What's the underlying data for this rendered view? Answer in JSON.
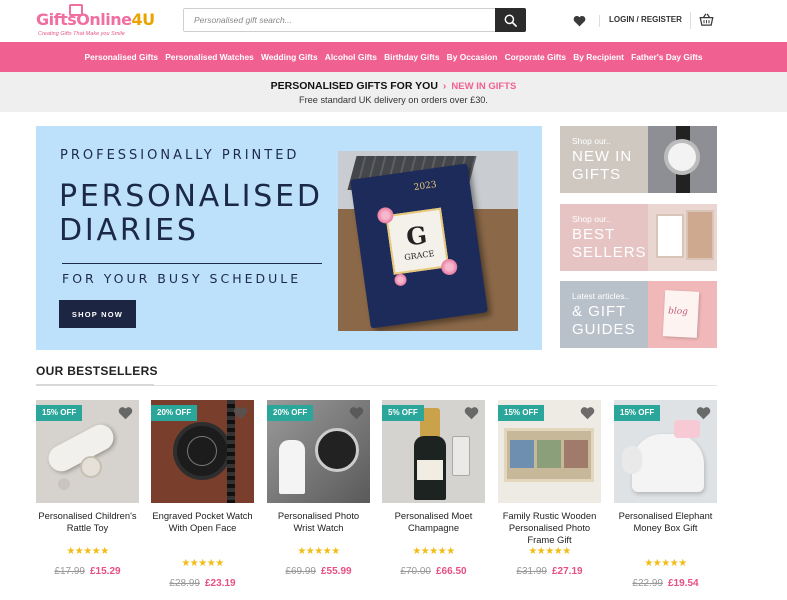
{
  "brand": {
    "logo_part1": "Gifts",
    "logo_part2": "Online",
    "logo_part3": "4U",
    "tagline": "Creating Gifts That Make you Smile"
  },
  "search": {
    "placeholder": "Personalised gift search..."
  },
  "account": {
    "login_label": "LOGIN / REGISTER"
  },
  "nav": {
    "items": [
      "Personalised Gifts",
      "Personalised Watches",
      "Wedding Gifts",
      "Alcohol Gifts",
      "Birthday Gifts",
      "By Occasion",
      "Corporate Gifts",
      "By Recipient",
      "Father's Day Gifts"
    ]
  },
  "promo": {
    "headline": "PERSONALISED GIFTS FOR YOU",
    "link": "NEW IN GIFTS",
    "delivery": "Free standard UK delivery on orders over £30."
  },
  "hero": {
    "eyebrow": "PROFESSIONALLY PRINTED",
    "title_line1": "PERSONALISED",
    "title_line2": "DIARIES",
    "subtitle": "FOR YOUR BUSY SCHEDULE",
    "button": "SHOP NOW",
    "diary_year": "2023",
    "diary_letter": "G",
    "diary_name": "GRACE"
  },
  "side_promos": [
    {
      "small": "Shop our..",
      "big_line1": "NEW IN",
      "big_line2": "GIFTS"
    },
    {
      "small": "Shop our..",
      "big_line1": "BEST",
      "big_line2": "SELLERS"
    },
    {
      "small": "Latest articles..",
      "big_line1": "& GIFT",
      "big_line2": "GUIDES",
      "image_text": "blog"
    }
  ],
  "bestsellers": {
    "title": "OUR BESTSELLERS",
    "products": [
      {
        "badge": "15% OFF",
        "name": "Personalised Children's Rattle Toy",
        "rating": "★★★★★",
        "old_price": "£17.99",
        "price": "£15.29"
      },
      {
        "badge": "20% OFF",
        "name": "Engraved Pocket Watch With Open Face",
        "rating": "★★★★★",
        "old_price": "£28.99",
        "price": "£23.19"
      },
      {
        "badge": "20% OFF",
        "name": "Personalised Photo Wrist Watch",
        "rating": "★★★★★",
        "old_price": "£69.99",
        "price": "£55.99"
      },
      {
        "badge": "5% OFF",
        "name": "Personalised Moet Champagne",
        "rating": "★★★★★",
        "old_price": "£70.00",
        "price": "£66.50"
      },
      {
        "badge": "15% OFF",
        "name": "Family Rustic Wooden Personalised Photo Frame Gift",
        "rating": "★★★★★",
        "old_price": "£31.99",
        "price": "£27.19"
      },
      {
        "badge": "15% OFF",
        "name": "Personalised Elephant Money Box Gift",
        "rating": "★★★★★",
        "old_price": "£22.99",
        "price": "£19.54"
      }
    ]
  },
  "colors": {
    "accent_pink": "#f06192",
    "badge_teal": "#2ba69a",
    "star": "#f2bc16",
    "price_pink": "#e84f83"
  },
  "icons": [
    "gift-icon",
    "search-icon",
    "heart-icon",
    "basket-icon",
    "wishlist-heart-icon"
  ]
}
